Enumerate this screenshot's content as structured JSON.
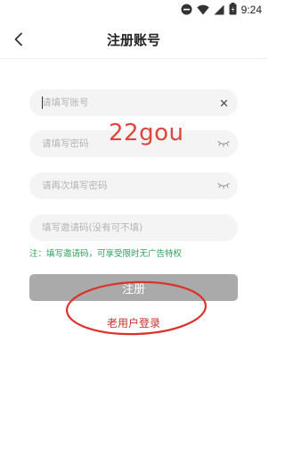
{
  "status_bar": {
    "time": "9:24"
  },
  "header": {
    "title": "注册账号"
  },
  "form": {
    "account": {
      "placeholder": "请填写账号"
    },
    "password": {
      "placeholder": "请填写密码"
    },
    "confirm_password": {
      "placeholder": "请再次填写密码"
    },
    "invite_code": {
      "placeholder": "填写邀请码(没有可不填)"
    },
    "note": "注：填写邀请码，可享受限时无广告特权",
    "register_label": "注册",
    "login_link": "老用户登录"
  },
  "watermark": "22gou",
  "colors": {
    "note_green": "#2e9f5e",
    "button_gray": "#aaaaaa",
    "link_red": "#c8302b",
    "annotation_red": "#d9332b"
  },
  "icons": [
    "back-icon",
    "clear-icon",
    "eye-closed-icon"
  ]
}
